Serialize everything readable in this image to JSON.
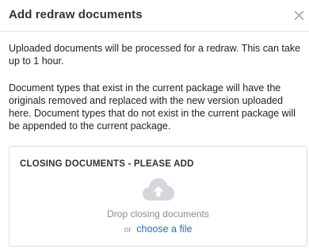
{
  "dialog": {
    "title": "Add redraw documents",
    "close_icon": "close-icon",
    "paragraph1": "Uploaded documents will be processed for a redraw. This can take up to 1 hour.",
    "paragraph2": "Document types that exist in the current package will have the originals removed and replaced with the new version uploaded here. Document types that do not exist in the current package will be appended to the current package."
  },
  "dropzone": {
    "title": "CLOSING DOCUMENTS - PLEASE ADD",
    "icon": "cloud-upload-icon",
    "drop_text": "Drop closing documents",
    "or_text": "or",
    "choose_link": "choose a file"
  },
  "colors": {
    "link": "#2a6db5",
    "icon_gray": "#d3d7db",
    "muted_text": "#8c8c8c",
    "border": "#dcdcdc"
  }
}
